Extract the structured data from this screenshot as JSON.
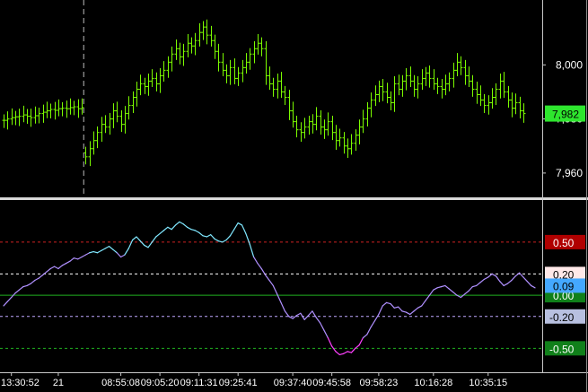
{
  "colors": {
    "background": "#000000",
    "price_bars": "#7CFC00",
    "frame": "#c8c8c8",
    "osc_cyan": "#80e8ff",
    "osc_violet": "#b090ff",
    "osc_magenta": "#ff40ff",
    "level_050": "#cc2222",
    "level_020": "#ffffff",
    "level_000": "#20b020",
    "level_m020": "#c0a8ff",
    "level_m050": "#20b020"
  },
  "price_axis": {
    "ticks": [
      {
        "value": 8000,
        "label": "8,000"
      },
      {
        "value": 7980,
        "label": "7,980"
      },
      {
        "value": 7960,
        "label": "7,960"
      }
    ],
    "last_price": {
      "value": 7982,
      "label": "7,982",
      "bg": "#2ee62e",
      "fg": "#000000"
    }
  },
  "osc_axis": {
    "levels": [
      {
        "value": 0.5,
        "label": "0.50",
        "line": "#cc2222",
        "dash": "3,3",
        "bg": "#b00000",
        "fg": "#ffffff"
      },
      {
        "value": 0.2,
        "label": "0.20",
        "line": "#ffffff",
        "dash": "3,3",
        "bg": "#ffe8e8",
        "fg": "#000000"
      },
      {
        "value": 0.0,
        "label": "0.00",
        "line": "#20b020",
        "dash": "",
        "bg": "#10801a",
        "fg": "#ffffff"
      },
      {
        "value": -0.2,
        "label": "-0.20",
        "line": "#c0a8ff",
        "dash": "3,3",
        "bg": "#b8c0e0",
        "fg": "#000000"
      },
      {
        "value": -0.5,
        "label": "-0.50",
        "line": "#20b020",
        "dash": "3,3",
        "bg": "#10801a",
        "fg": "#ffffff"
      }
    ],
    "current": {
      "value": 0.09,
      "label": "0.09",
      "bg": "#44a8ff",
      "fg": "#000000"
    }
  },
  "time_axis": {
    "labels": [
      "13:30:52",
      "21",
      "08:55:08",
      "09:05:20",
      "09:11:31",
      "09:25:41",
      "09:37:40",
      "09:45:58",
      "09:58:23",
      "10:16:28",
      "10:35:15"
    ],
    "label_bar_index": [
      2,
      14,
      30,
      40,
      50,
      60,
      74,
      84,
      96,
      110,
      124
    ]
  },
  "chart_data": [
    {
      "type": "line",
      "subtype": "ohlc-bars",
      "x": [
        0,
        1,
        2,
        3,
        4,
        5,
        6,
        7,
        8,
        9,
        10,
        11,
        12,
        13,
        14,
        15,
        16,
        17,
        18,
        19,
        20,
        21,
        22,
        23,
        24,
        25,
        26,
        27,
        28,
        29,
        30,
        31,
        32,
        33,
        34,
        35,
        36,
        37,
        38,
        39,
        40,
        41,
        42,
        43,
        44,
        45,
        46,
        47,
        48,
        49,
        50,
        51,
        52,
        53,
        54,
        55,
        56,
        57,
        58,
        59,
        60,
        61,
        62,
        63,
        64,
        65,
        66,
        67,
        68,
        69,
        70,
        71,
        72,
        73,
        74,
        75,
        76,
        77,
        78,
        79,
        80,
        81,
        82,
        83,
        84,
        85,
        86,
        87,
        88,
        89,
        90,
        91,
        92,
        93,
        94,
        95,
        96,
        97,
        98,
        99,
        100,
        101,
        102,
        103,
        104,
        105,
        106,
        107,
        108,
        109,
        110,
        111,
        112,
        113,
        114,
        115,
        116,
        117,
        118,
        119,
        120,
        121,
        122,
        123,
        124,
        125,
        126,
        127,
        128,
        129,
        130,
        131,
        132,
        133,
        134,
        135,
        136
      ],
      "series": [
        {
          "values": [
            7979.5,
            7980.0,
            7980.5,
            7980.8,
            7981.0,
            7981.5,
            7981.0,
            7980.5,
            7981.2,
            7982.0,
            7982.5,
            7983.0,
            7983.5,
            7983.2,
            7983.8,
            7984.0,
            7983.8,
            7984.2,
            7984.5,
            7983.8,
            7984.2,
            7966.0,
            7969.0,
            7972.0,
            7975.0,
            7978.0,
            7977.0,
            7980.0,
            7983.0,
            7981.0,
            7978.0,
            7982.0,
            7985.0,
            7988.0,
            7991.0,
            7993.0,
            7992.0,
            7994.0,
            7995.0,
            7993.0,
            7996.0,
            7998.0,
            8001.0,
            8004.0,
            8006.0,
            8003.0,
            8005.0,
            8008.0,
            8007.0,
            8009.0,
            8012.0,
            8014.0,
            8011.0,
            8009.0,
            8005.0,
            8001.0,
            7998.0,
            7996.0,
            7999.0,
            7995.0,
            7997.0,
            7999.0,
            8001.0,
            8004.0,
            8006.0,
            8008.0,
            8006.0,
            7996.0,
            7993.0,
            7991.0,
            7994.0,
            7990.0,
            7988.0,
            7983.0,
            7979.0,
            7976.0,
            7975.0,
            7977.0,
            7979.0,
            7978.0,
            7981.0,
            7977.0,
            7976.0,
            7979.0,
            7975.0,
            7972.0,
            7973.0,
            7970.0,
            7969.0,
            7971.0,
            7974.0,
            7977.0,
            7980.0,
            7984.0,
            7987.0,
            7989.0,
            7992.0,
            7990.0,
            7988.0,
            7986.0,
            7993.0,
            7991.0,
            7994.0,
            7996.0,
            7994.0,
            7991.0,
            7993.0,
            7995.0,
            7997.0,
            7995.0,
            7993.0,
            7992.0,
            7991.0,
            7993.0,
            7995.0,
            7998.0,
            8001.0,
            7999.0,
            7996.0,
            7994.0,
            7991.0,
            7989.0,
            7987.0,
            7985.0,
            7986.0,
            7988.0,
            7991.0,
            7994.0,
            7990.0,
            7987.0,
            7984.0,
            7986.0,
            7983.0,
            7982.0
          ]
        }
      ],
      "ylim": [
        7953,
        8024
      ],
      "ticks": [
        7960,
        7980,
        8000
      ],
      "session_break_index": 21,
      "grid": false
    },
    {
      "type": "line",
      "x": [
        0,
        1,
        2,
        3,
        4,
        5,
        6,
        7,
        8,
        9,
        10,
        11,
        12,
        13,
        14,
        15,
        16,
        17,
        18,
        19,
        20,
        21,
        22,
        23,
        24,
        25,
        26,
        27,
        28,
        29,
        30,
        31,
        32,
        33,
        34,
        35,
        36,
        37,
        38,
        39,
        40,
        41,
        42,
        43,
        44,
        45,
        46,
        47,
        48,
        49,
        50,
        51,
        52,
        53,
        54,
        55,
        56,
        57,
        58,
        59,
        60,
        61,
        62,
        63,
        64,
        65,
        66,
        67,
        68,
        69,
        70,
        71,
        72,
        73,
        74,
        75,
        76,
        77,
        78,
        79,
        80,
        81,
        82,
        83,
        84,
        85,
        86,
        87,
        88,
        89,
        90,
        91,
        92,
        93,
        94,
        95,
        96,
        97,
        98,
        99,
        100,
        101,
        102,
        103,
        104,
        105,
        106,
        107,
        108,
        109,
        110,
        111,
        112,
        113,
        114,
        115,
        116,
        117,
        118,
        119,
        120,
        121,
        122,
        123,
        124,
        125,
        126,
        127,
        128,
        129,
        130,
        131,
        132,
        133,
        134,
        135,
        136
      ],
      "series": [
        {
          "values": [
            -0.1,
            -0.06,
            -0.02,
            0.02,
            0.05,
            0.08,
            0.09,
            0.11,
            0.14,
            0.16,
            0.19,
            0.22,
            0.25,
            0.27,
            0.25,
            0.28,
            0.3,
            0.32,
            0.35,
            0.34,
            0.36,
            0.38,
            0.4,
            0.41,
            0.4,
            0.42,
            0.44,
            0.46,
            0.43,
            0.4,
            0.36,
            0.38,
            0.44,
            0.52,
            0.55,
            0.51,
            0.47,
            0.45,
            0.5,
            0.55,
            0.58,
            0.61,
            0.64,
            0.62,
            0.66,
            0.69,
            0.67,
            0.64,
            0.62,
            0.61,
            0.59,
            0.56,
            0.55,
            0.57,
            0.53,
            0.51,
            0.5,
            0.52,
            0.56,
            0.62,
            0.68,
            0.66,
            0.58,
            0.48,
            0.36,
            0.3,
            0.25,
            0.19,
            0.14,
            0.09,
            0.01,
            -0.07,
            -0.15,
            -0.2,
            -0.22,
            -0.19,
            -0.17,
            -0.23,
            -0.19,
            -0.15,
            -0.21,
            -0.26,
            -0.33,
            -0.4,
            -0.48,
            -0.53,
            -0.56,
            -0.55,
            -0.53,
            -0.54,
            -0.5,
            -0.47,
            -0.4,
            -0.37,
            -0.3,
            -0.24,
            -0.18,
            -0.1,
            -0.07,
            -0.08,
            -0.12,
            -0.11,
            -0.15,
            -0.16,
            -0.18,
            -0.15,
            -0.12,
            -0.1,
            -0.05,
            0.0,
            0.05,
            0.07,
            0.08,
            0.09,
            0.06,
            0.03,
            0.0,
            -0.02,
            0.01,
            0.04,
            0.08,
            0.09,
            0.12,
            0.15,
            0.17,
            0.2,
            0.18,
            0.13,
            0.09,
            0.11,
            0.14,
            0.18,
            0.21,
            0.17,
            0.13,
            0.09,
            0.07
          ]
        }
      ],
      "ylim": [
        -0.7,
        0.82
      ],
      "ticks": [
        -0.5,
        -0.2,
        0.0,
        0.2,
        0.5
      ],
      "grid": false
    }
  ]
}
